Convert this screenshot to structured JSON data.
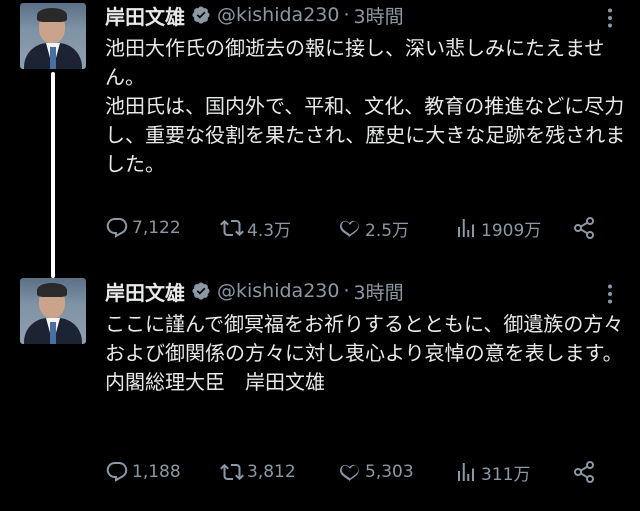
{
  "tweets": [
    {
      "author": {
        "name": "岸田文雄",
        "handle": "@kishida230",
        "time": "3時間",
        "verified": true
      },
      "text_lines": [
        "池田大作氏の御逝去の報に接し、深い悲しみにたえません。",
        "池田氏は、国内外で、平和、文化、教育の推進などに尽力し、重要な役割を果たされ、歴史に大きな足跡を残されました。"
      ],
      "stats": {
        "replies": "7,122",
        "retweets": "4.3万",
        "likes": "2.5万",
        "views": "1909万"
      }
    },
    {
      "author": {
        "name": "岸田文雄",
        "handle": "@kishida230",
        "time": "3時間",
        "verified": true
      },
      "text_lines": [
        "ここに謹んで御冥福をお祈りするとともに、御遺族の方々および御関係の方々に対し衷心より哀悼の意を表します。",
        "内閣総理大臣　岸田文雄"
      ],
      "stats": {
        "replies": "1,188",
        "retweets": "3,812",
        "likes": "5,303",
        "views": "311万"
      }
    }
  ],
  "icons": {
    "verified": "verified-badge-icon",
    "more": "more-options-icon",
    "reply": "reply-icon",
    "retweet": "retweet-icon",
    "like": "heart-icon",
    "views": "views-chart-icon",
    "share": "share-icon"
  },
  "colors": {
    "background": "#000000",
    "text": "#e7e9ea",
    "secondary": "#8b98a5"
  }
}
